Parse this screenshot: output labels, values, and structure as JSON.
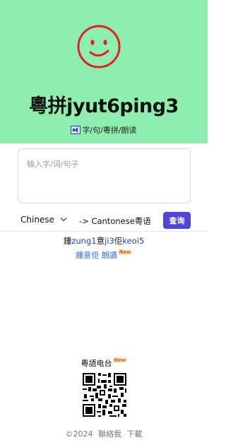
{
  "header": {
    "logo_icon": "smiley-face-icon",
    "title": "粵拼jyut6ping3",
    "subtitle_icon": "speaker-icon",
    "subtitle": "字/句/粵拼/朗读"
  },
  "search": {
    "placeholder": "输入字/词/句子",
    "value": ""
  },
  "controls": {
    "source_language": "Chinese",
    "target_label": "-> Cantonese粵语",
    "query_button": "查询"
  },
  "result": {
    "prefix": "鍾",
    "jyutping_1": "zung1",
    "char_2": "意",
    "jyutping_2": "ji3",
    "char_3": "佢",
    "jyutping_3": "keoi5",
    "link_text": "鍾意佢",
    "read_aloud": "朗讀",
    "new_badge": "New"
  },
  "radio": {
    "label": "粵語电台",
    "new_badge": "New"
  },
  "footer": {
    "copyright": "©2024",
    "contact": "聯絡我",
    "download": "下載"
  },
  "colors": {
    "hero_bg": "#8EEEB0",
    "accent": "#4f45d9",
    "jyutping": "#1f3fd8",
    "smiley": "#e0231f"
  }
}
